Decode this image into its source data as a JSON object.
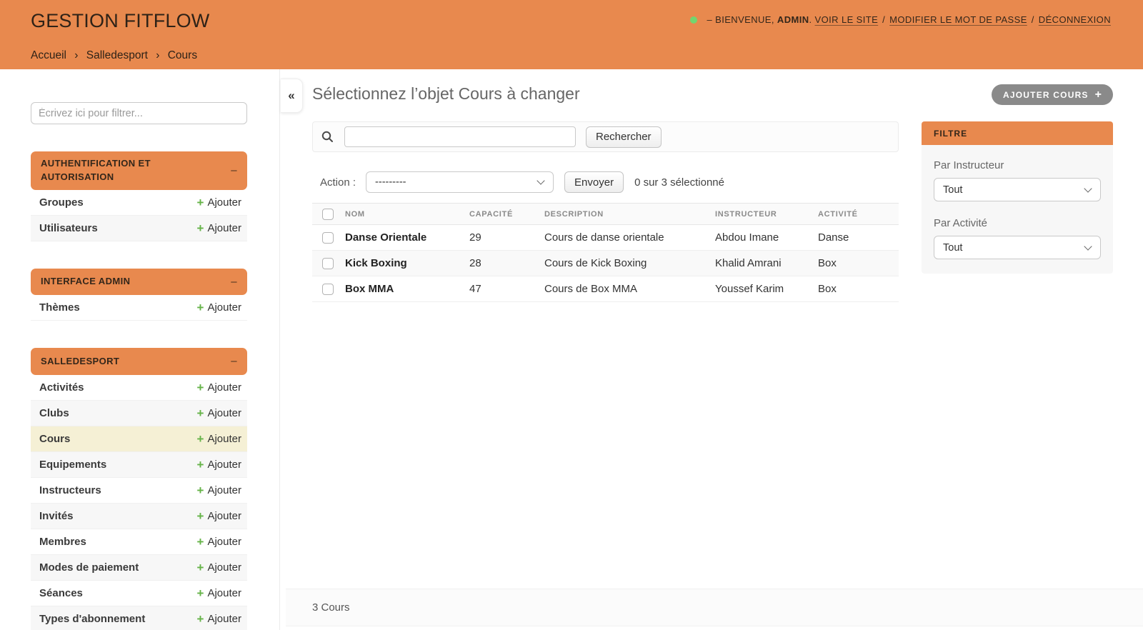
{
  "header": {
    "site_title": "GESTION FITFLOW",
    "breadcrumb": {
      "items": [
        "Accueil",
        "Salledesport",
        "Cours"
      ],
      "separator": "›"
    },
    "user_tools": {
      "welcome_prefix": "– BIENVENUE,",
      "username": "ADMIN",
      "suffix": ".",
      "links": [
        "VOIR LE SITE",
        "MODIFIER LE MOT DE PASSE",
        "DÉCONNEXION"
      ],
      "separator": "/"
    }
  },
  "sidebar": {
    "filter_placeholder": "Écrivez ici pour filtrer...",
    "add_icon": "+",
    "add_label": "Ajouter",
    "collapse_glyph": "–",
    "sections": [
      {
        "title": "AUTHENTIFICATION ET AUTORISATION",
        "items": [
          {
            "label": "Groupes"
          },
          {
            "label": "Utilisateurs"
          }
        ]
      },
      {
        "title": "INTERFACE ADMIN",
        "items": [
          {
            "label": "Thèmes"
          }
        ]
      },
      {
        "title": "SALLEDESPORT",
        "items": [
          {
            "label": "Activités"
          },
          {
            "label": "Clubs"
          },
          {
            "label": "Cours"
          },
          {
            "label": "Equipements"
          },
          {
            "label": "Instructeurs"
          },
          {
            "label": "Invités"
          },
          {
            "label": "Membres"
          },
          {
            "label": "Modes de paiement"
          },
          {
            "label": "Séances"
          },
          {
            "label": "Types d'abonnement"
          }
        ]
      }
    ]
  },
  "main": {
    "collapse_button": "«",
    "page_title": "Sélectionnez l’objet Cours à changer",
    "add_button": {
      "label": "AJOUTER COURS",
      "icon": "+"
    },
    "search": {
      "button_label": "Rechercher",
      "value": ""
    },
    "actions": {
      "label": "Action :",
      "selected_option": "---------",
      "submit_label": "Envoyer",
      "selection_note": "0 sur 3 sélectionné"
    },
    "table": {
      "columns": [
        "NOM",
        "CAPACITÉ",
        "DESCRIPTION",
        "INSTRUCTEUR",
        "ACTIVITÉ"
      ],
      "rows": [
        {
          "nom": "Danse Orientale",
          "capacite": "29",
          "description": "Cours de danse orientale",
          "instructeur": "Abdou Imane",
          "activite": "Danse"
        },
        {
          "nom": "Kick Boxing",
          "capacite": "28",
          "description": "Cours de Kick Boxing",
          "instructeur": "Khalid Amrani",
          "activite": "Box"
        },
        {
          "nom": "Box MMA",
          "capacite": "47",
          "description": "Cours de Box MMA",
          "instructeur": "Youssef Karim",
          "activite": "Box"
        }
      ]
    },
    "pagination": "3 Cours"
  },
  "filter_panel": {
    "title": "FILTRE",
    "groups": [
      {
        "label": "Par Instructeur",
        "selected": "Tout"
      },
      {
        "label": "Par Activité",
        "selected": "Tout"
      }
    ]
  },
  "colors": {
    "accent": "#E8894E",
    "accent_text": "#33261A",
    "selected_row_bg": "#F5F0D5",
    "add_icon_green": "#65B348",
    "status_dot_green": "#72D66F",
    "add_button_gray": "#8A8A8A"
  }
}
